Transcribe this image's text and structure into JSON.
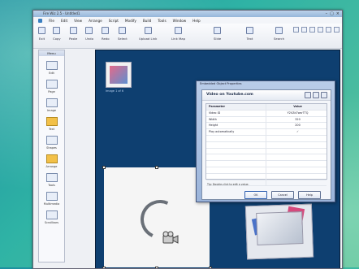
{
  "window": {
    "title": "Fire Wiz 2.5 - Untitled1",
    "controls": [
      "–",
      "▢",
      "×"
    ]
  },
  "menubar": [
    "File",
    "Edit",
    "View",
    "Arrange",
    "Script",
    "Modify",
    "Build",
    "Tools",
    "Window",
    "Help"
  ],
  "toolbar": [
    {
      "label": "Exit",
      "icon": "exit-icon"
    },
    {
      "label": "Copy",
      "icon": "copy-icon"
    },
    {
      "label": "Paste",
      "icon": "paste-icon"
    },
    {
      "label": "Undo",
      "icon": "undo-icon"
    },
    {
      "label": "Redo",
      "icon": "redo-icon"
    },
    {
      "label": "Select",
      "icon": "select-icon"
    },
    {
      "label": "Upload Link",
      "icon": "upload-link-icon"
    },
    {
      "label": "Link Map",
      "icon": "link-map-icon"
    },
    {
      "label": "Slide",
      "icon": "slide-icon"
    },
    {
      "label": "Text",
      "icon": "text-icon"
    },
    {
      "label": "Search",
      "icon": "search-icon"
    }
  ],
  "left_panel": {
    "header": "Menu",
    "items": [
      "Edit",
      "Page",
      "Image",
      "Text",
      "Shapes",
      "Arrange",
      "Tools",
      "Multimedia",
      "Scrollbars"
    ]
  },
  "canvas": {
    "thumb_label": "Image 1 of 6"
  },
  "dialog": {
    "frame_title": "Embedded Object Properties",
    "title": "Video on Youtube.com",
    "table": {
      "headers": [
        "Parameter",
        "Value"
      ],
      "rows": [
        [
          "Video ID",
          "Y2VZd7wsrTTQ"
        ],
        [
          "Width",
          "320"
        ],
        [
          "Height",
          "200"
        ],
        [
          "Play automatically",
          "✓"
        ],
        [
          "",
          ""
        ],
        [
          "",
          ""
        ],
        [
          "",
          ""
        ],
        [
          "",
          ""
        ],
        [
          "",
          ""
        ],
        [
          "",
          ""
        ],
        [
          "",
          ""
        ],
        [
          "",
          ""
        ]
      ]
    },
    "hint": "Tip: Double-click to edit a value.",
    "buttons": {
      "ok": "OK",
      "cancel": "Cancel",
      "help": "Help"
    }
  }
}
